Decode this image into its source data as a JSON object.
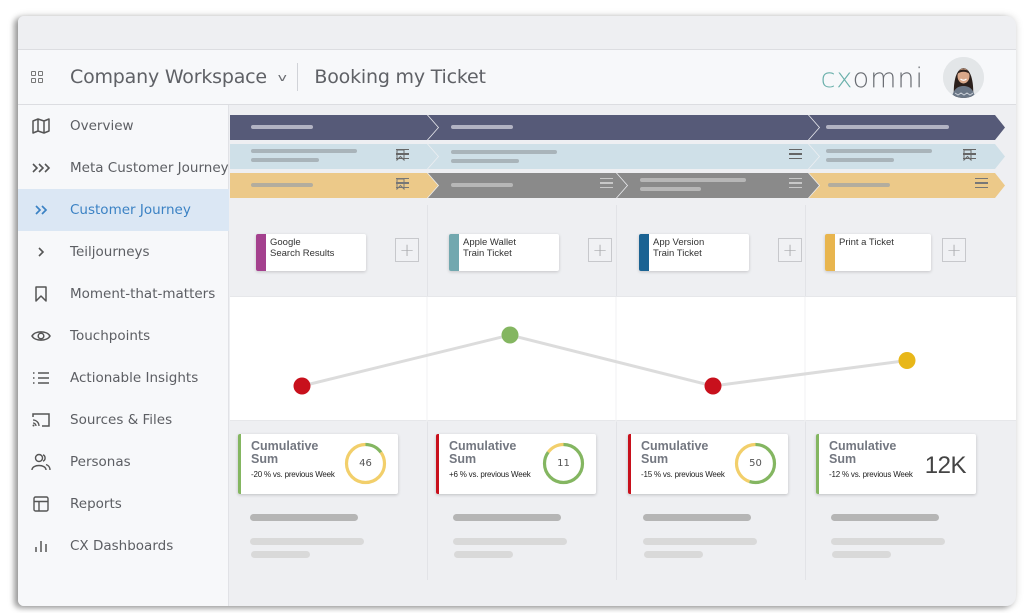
{
  "header": {
    "workspace": "Company Workspace",
    "page_title": "Booking my Ticket",
    "logo_prefix": "cx",
    "logo_suffix": "omni"
  },
  "sidebar": {
    "items": [
      {
        "label": "Overview",
        "icon": "map-icon",
        "active": false
      },
      {
        "label": "Meta Customer Journey",
        "icon": "triple-chevron-icon",
        "active": false
      },
      {
        "label": "Customer Journey",
        "icon": "double-chevron-icon",
        "active": true
      },
      {
        "label": "Teiljourneys",
        "icon": "chevron-right-icon",
        "active": false
      },
      {
        "label": "Moment-that-matters",
        "icon": "bookmark-icon",
        "active": false
      },
      {
        "label": "Touchpoints",
        "icon": "eye-icon",
        "active": false
      },
      {
        "label": "Actionable Insights",
        "icon": "list-icon",
        "active": false
      },
      {
        "label": "Sources & Files",
        "icon": "cast-icon",
        "active": false
      },
      {
        "label": "Personas",
        "icon": "users-icon",
        "active": false
      },
      {
        "label": "Reports",
        "icon": "table-icon",
        "active": false
      },
      {
        "label": "CX Dashboards",
        "icon": "bar-chart-icon",
        "active": false
      }
    ]
  },
  "colors": {
    "phase_lane": "#565a78",
    "stage_lane": "#cfe0e8",
    "step_lane_yellow": "#ecc989",
    "step_lane_gray": "#8a8a8a",
    "active_blue": "#3b82c4",
    "red": "#c8101c",
    "green": "#84b661",
    "yellow": "#e8b719"
  },
  "touchpoints": [
    {
      "line1": "Google",
      "line2": "Search Results",
      "color": "#a4418e"
    },
    {
      "line1": "Apple Wallet",
      "line2": "Train Ticket",
      "color": "#72a8af"
    },
    {
      "line1": "App Version",
      "line2": "Train Ticket",
      "color": "#1b6393"
    },
    {
      "line1": "Print a Ticket",
      "line2": "",
      "color": "#e8b54e"
    }
  ],
  "chart_data": {
    "type": "line",
    "title": "",
    "categories": [
      "Google Search Results",
      "Apple Wallet Train Ticket",
      "App Version Train Ticket",
      "Print a Ticket"
    ],
    "values": [
      1,
      3,
      1,
      2
    ],
    "point_status": [
      "red",
      "green",
      "red",
      "yellow"
    ],
    "ylim": [
      0,
      4
    ],
    "xlabel": "",
    "ylabel": "",
    "grid": false
  },
  "kpis": [
    {
      "title_line1": "Cumulative",
      "title_line2": "Sum",
      "subtitle": "-20 % vs. previous Week",
      "value": "46",
      "type": "donut",
      "green_fraction": 0.15,
      "strip": "#84b661"
    },
    {
      "title_line1": "Cumulative",
      "title_line2": "Sum",
      "subtitle": "+6 % vs. previous Week",
      "value": "11",
      "type": "donut",
      "green_fraction": 0.85,
      "strip": "#c8101c"
    },
    {
      "title_line1": "Cumulative",
      "title_line2": "Sum",
      "subtitle": "-15 % vs. previous Week",
      "value": "50",
      "type": "donut",
      "green_fraction": 0.55,
      "strip": "#c8101c"
    },
    {
      "title_line1": "Cumulative",
      "title_line2": "Sum",
      "subtitle": "-12 % vs. previous Week",
      "value": "12K",
      "type": "number",
      "strip": "#84b661"
    }
  ]
}
